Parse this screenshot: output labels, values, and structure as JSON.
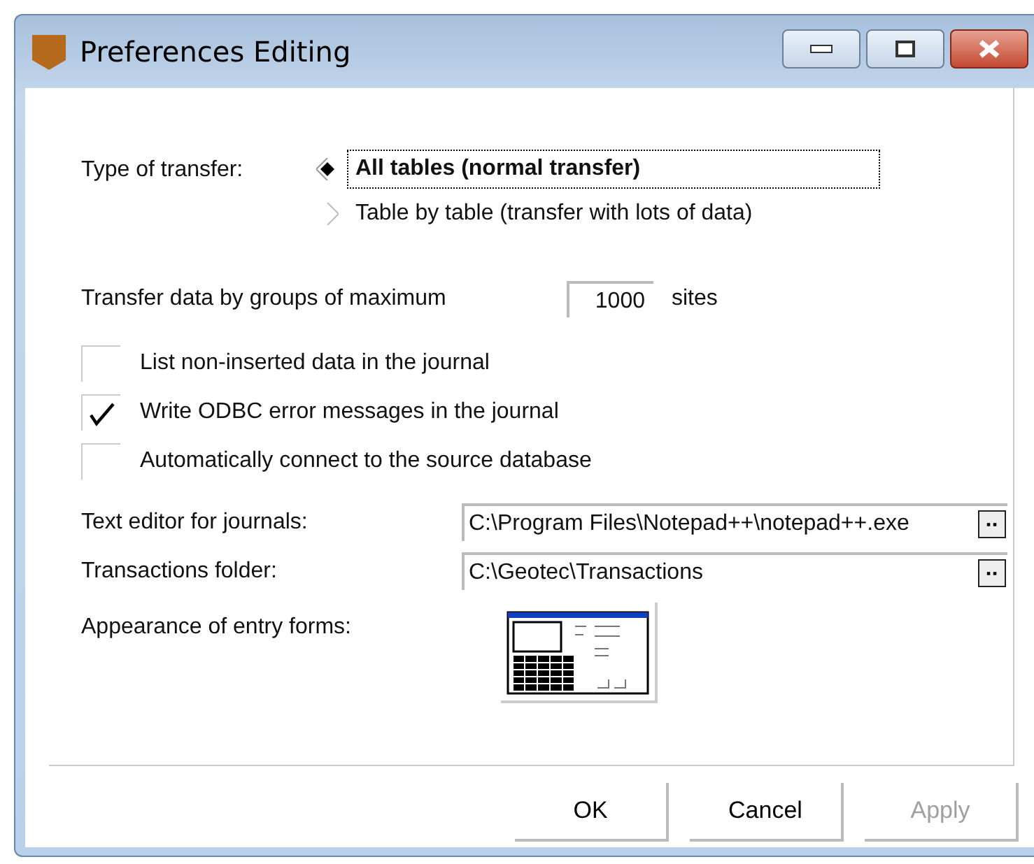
{
  "window": {
    "title": "Preferences Editing"
  },
  "transfer_type": {
    "label": "Type of transfer:",
    "options": [
      {
        "label": "All tables (normal transfer)",
        "selected": true
      },
      {
        "label": "Table by table (transfer with lots of data)",
        "selected": false
      }
    ]
  },
  "group_size": {
    "label": "Transfer data by groups of maximum",
    "value": "1000",
    "unit": "sites"
  },
  "options": [
    {
      "label": "List non-inserted data in the journal",
      "checked": false
    },
    {
      "label": "Write ODBC error messages in the journal",
      "checked": true
    },
    {
      "label": "Automatically connect to the source database",
      "checked": false
    }
  ],
  "paths": [
    {
      "label": "Text editor for journals:",
      "value": "C:\\Program Files\\Notepad++\\notepad++.exe"
    },
    {
      "label": "Transactions folder:",
      "value": "C:\\Geotec\\Transactions"
    }
  ],
  "appearance": {
    "label": "Appearance of entry forms:"
  },
  "buttons": [
    {
      "label": "OK",
      "disabled": false
    },
    {
      "label": "Cancel",
      "disabled": false
    },
    {
      "label": "Apply",
      "disabled": true
    }
  ]
}
